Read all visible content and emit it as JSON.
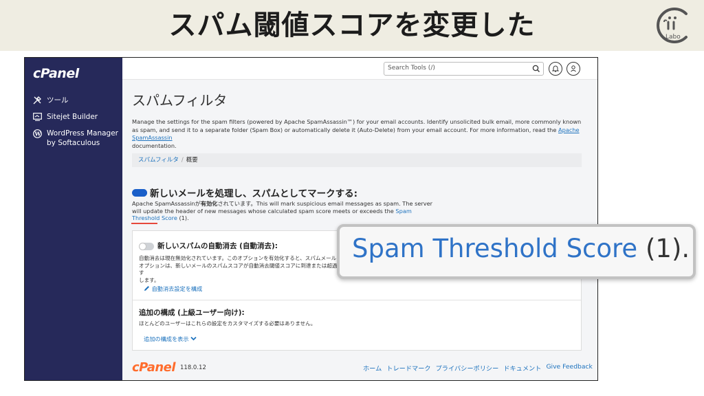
{
  "banner": {
    "title": "スパム閾値スコアを変更した",
    "logo_text": "chii Labo"
  },
  "sidebar": {
    "logo": "cPanel",
    "items": [
      {
        "label": "ツール",
        "icon": "tools-icon"
      },
      {
        "label": "Sitejet Builder",
        "icon": "sitejet-icon"
      },
      {
        "label": "WordPress Manager by Softaculous",
        "icon": "wordpress-icon"
      }
    ]
  },
  "topbar": {
    "search_placeholder": "Search Tools (/)"
  },
  "page": {
    "title": "スパムフィルタ",
    "desc_text": "Manage the settings for the spam filters (powered by Apache SpamAssassin™) for your email accounts. Identify unsolicited bulk email, more commonly known as spam, and send it to a separate folder (Spam Box) or automatically delete it (Auto-Delete) from your email account. For more information, read the ",
    "desc_link": "Apache SpamAssassin",
    "desc_tail": "documentation."
  },
  "breadcrumb": {
    "parent": "スパムフィルタ",
    "separator": "/",
    "current": "概要"
  },
  "section_process": {
    "title": "新しいメールを処理し、スパムとしてマークする:",
    "desc_pre": "Apache SpamAssassinが",
    "desc_bold": "有効化",
    "desc_mid": "されています。This will mark suspicious email messages as spam. The server will update the header of new messages whose calculated spam score meets or exceeds the ",
    "desc_link": "Spam Threshold Score",
    "desc_suffix": " (1).",
    "enabled": true
  },
  "section_autodelete": {
    "title": "新しいスパムの自動消去 (自動消去):",
    "desc_line1": "自動消去は現在無効化されています。このオプションを有効化すると、スパムメール",
    "desc_line2": "オプションは、新しいメールのスパムスコアが自動消去閾値スコアに到達または超過す",
    "desc_line3": "します。",
    "link": "自動消去設定を構成",
    "enabled": false
  },
  "section_advanced": {
    "title": "追加の構成 (上級ユーザー向け):",
    "desc": "ほとんどのユーザーはこれらの設定をカスタマイズする必要はありません。",
    "link": "追加の構成を表示"
  },
  "footer": {
    "logo": "cPanel",
    "version": "118.0.12",
    "links": [
      "ホーム",
      "トレードマーク",
      "プライバシーポリシー",
      "ドキュメント",
      "Give Feedback"
    ]
  },
  "callout": {
    "link_part1": "Spam Threshold",
    "link_part2": "Score",
    "suffix": " (1)."
  },
  "colors": {
    "sidebar_bg": "#26295a",
    "link": "#1e73be",
    "toggle_on": "#1a5fc9",
    "cpanel_orange": "#ff6c2c",
    "underline_red": "#e6483b"
  }
}
